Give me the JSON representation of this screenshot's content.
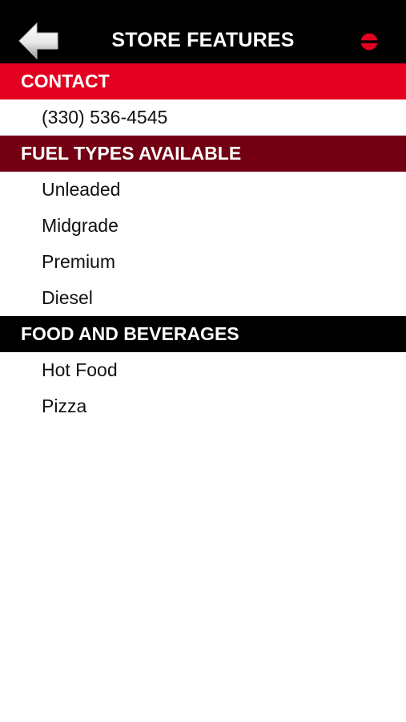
{
  "header": {
    "title": "STORE FEATURES",
    "back_icon": "back-arrow-icon",
    "logo_icon": "brand-logo-icon",
    "background": "#000000"
  },
  "sections": [
    {
      "title": "CONTACT",
      "color": "#e30020",
      "items": [
        "(330) 536-4545"
      ]
    },
    {
      "title": "FUEL TYPES AVAILABLE",
      "color": "#720012",
      "items": [
        "Unleaded",
        "Midgrade",
        "Premium",
        "Diesel"
      ]
    },
    {
      "title": "FOOD AND BEVERAGES",
      "color": "#000000",
      "items": [
        "Hot Food",
        "Pizza"
      ]
    }
  ]
}
